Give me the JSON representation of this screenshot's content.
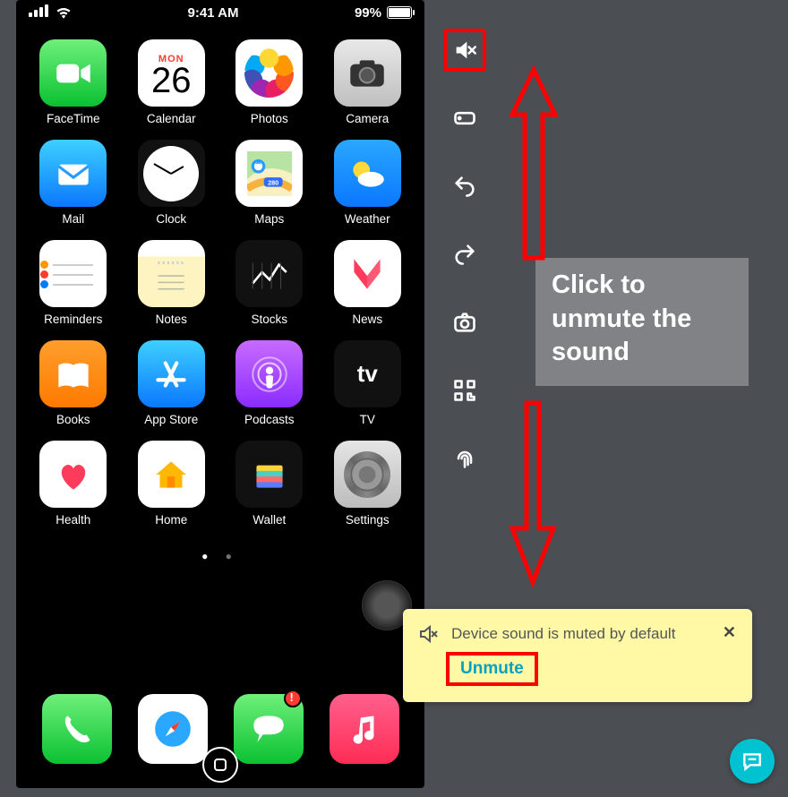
{
  "status": {
    "time": "9:41 AM",
    "battery_pct": "99%"
  },
  "calendar": {
    "dow": "MON",
    "day": "26"
  },
  "apps": [
    {
      "id": "facetime",
      "label": "FaceTime"
    },
    {
      "id": "calendar",
      "label": "Calendar"
    },
    {
      "id": "photos",
      "label": "Photos"
    },
    {
      "id": "camera",
      "label": "Camera"
    },
    {
      "id": "mail",
      "label": "Mail"
    },
    {
      "id": "clock",
      "label": "Clock"
    },
    {
      "id": "maps",
      "label": "Maps"
    },
    {
      "id": "weather",
      "label": "Weather"
    },
    {
      "id": "reminders",
      "label": "Reminders"
    },
    {
      "id": "notes",
      "label": "Notes"
    },
    {
      "id": "stocks",
      "label": "Stocks"
    },
    {
      "id": "news",
      "label": "News"
    },
    {
      "id": "books",
      "label": "Books"
    },
    {
      "id": "appstore",
      "label": "App Store"
    },
    {
      "id": "podcasts",
      "label": "Podcasts"
    },
    {
      "id": "tv",
      "label": "TV"
    },
    {
      "id": "health",
      "label": "Health"
    },
    {
      "id": "home",
      "label": "Home"
    },
    {
      "id": "wallet",
      "label": "Wallet"
    },
    {
      "id": "settings",
      "label": "Settings"
    }
  ],
  "dock": [
    "phone",
    "safari",
    "messages",
    "music"
  ],
  "toolbar": {
    "mute": "mute-icon",
    "rotate": "rotate-icon",
    "undo": "undo-icon",
    "redo": "redo-icon",
    "screenshot": "screenshot-icon",
    "scan": "scan-icon",
    "biometric": "biometric-icon"
  },
  "annotation": {
    "text": "Click to unmute the sound"
  },
  "toast": {
    "message": "Device sound is muted by default",
    "action": "Unmute"
  },
  "maps_badge": "280",
  "tv_label": "tv"
}
